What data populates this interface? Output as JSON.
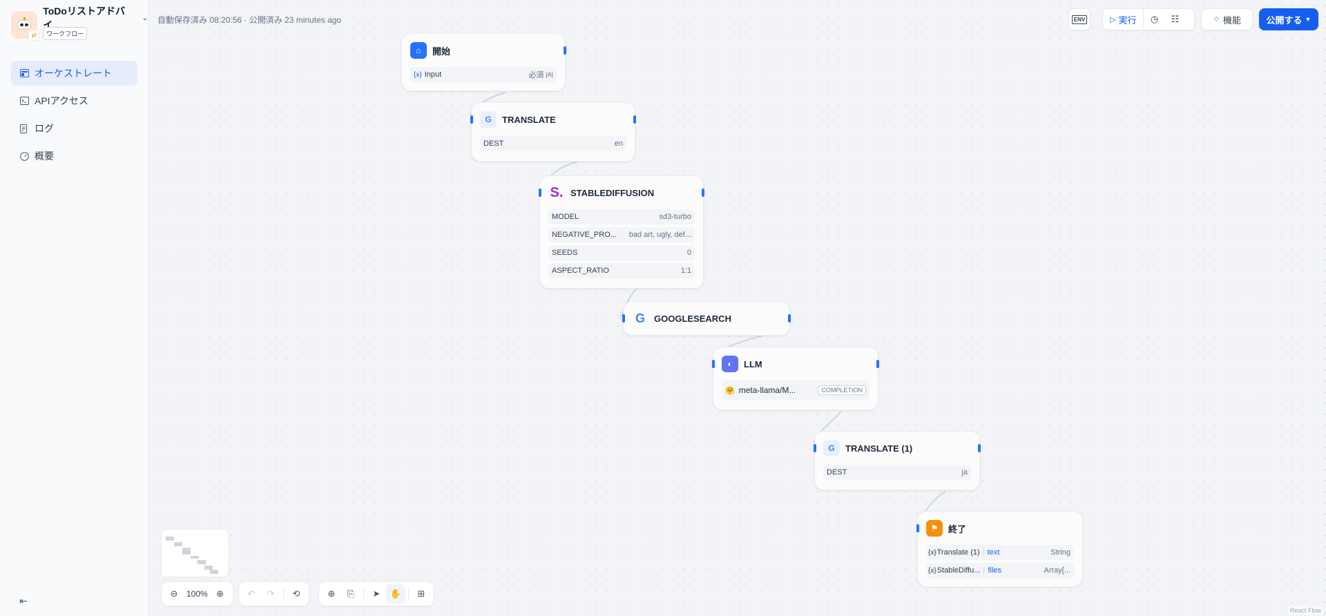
{
  "app": {
    "name": "ToDoリストアドバイ...",
    "type_badge": "ワークフロー"
  },
  "sidebar": {
    "items": [
      {
        "label": "オーケストレート",
        "icon": "layout-icon",
        "active": true
      },
      {
        "label": "APIアクセス",
        "icon": "terminal-icon",
        "active": false
      },
      {
        "label": "ログ",
        "icon": "file-list-icon",
        "active": false
      },
      {
        "label": "概要",
        "icon": "dashboard-icon",
        "active": false
      }
    ]
  },
  "status": "自動保存済み 08:20:56 · 公開済み 23 minutes ago",
  "toolbar": {
    "env_label": "ENV",
    "run_label": "実行",
    "features_label": "機能",
    "publish_label": "公開する"
  },
  "nodes": {
    "start": {
      "title": "開始",
      "rows": [
        {
          "var": "{x}",
          "name": "Input",
          "required": "必須",
          "type": "|A|"
        }
      ]
    },
    "translate": {
      "title": "TRANSLATE",
      "rows": [
        {
          "key": "DEST",
          "value": "en"
        }
      ]
    },
    "sd": {
      "title": "STABLEDIFFUSION",
      "rows": [
        {
          "key": "MODEL",
          "value": "sd3-turbo"
        },
        {
          "key": "NEGATIVE_PRO...",
          "value": "bad art, ugly, def..."
        },
        {
          "key": "SEEDS",
          "value": "0"
        },
        {
          "key": "ASPECT_RATIO",
          "value": "1:1"
        }
      ]
    },
    "google": {
      "title": "GOOGLESEARCH"
    },
    "llm": {
      "title": "LLM",
      "model": "meta-llama/M...",
      "mode": "COMPLETION"
    },
    "translate2": {
      "title": "TRANSLATE (1)",
      "rows": [
        {
          "key": "DEST",
          "value": "ja"
        }
      ]
    },
    "end": {
      "title": "終了",
      "rows": [
        {
          "var": "{x}",
          "src": "Translate (1)",
          "field": "text",
          "type": "String"
        },
        {
          "var": "{x}",
          "src": "StableDiffu...",
          "field": "files",
          "type": "Array[..."
        }
      ]
    }
  },
  "zoom": "100%",
  "attribution": "React Flow",
  "colors": {
    "primary": "#155eef",
    "start_icon": "#2970ff",
    "llm_icon": "#6172f3",
    "end_icon": "#f79009",
    "sd_icon": "#9e2fd6"
  }
}
